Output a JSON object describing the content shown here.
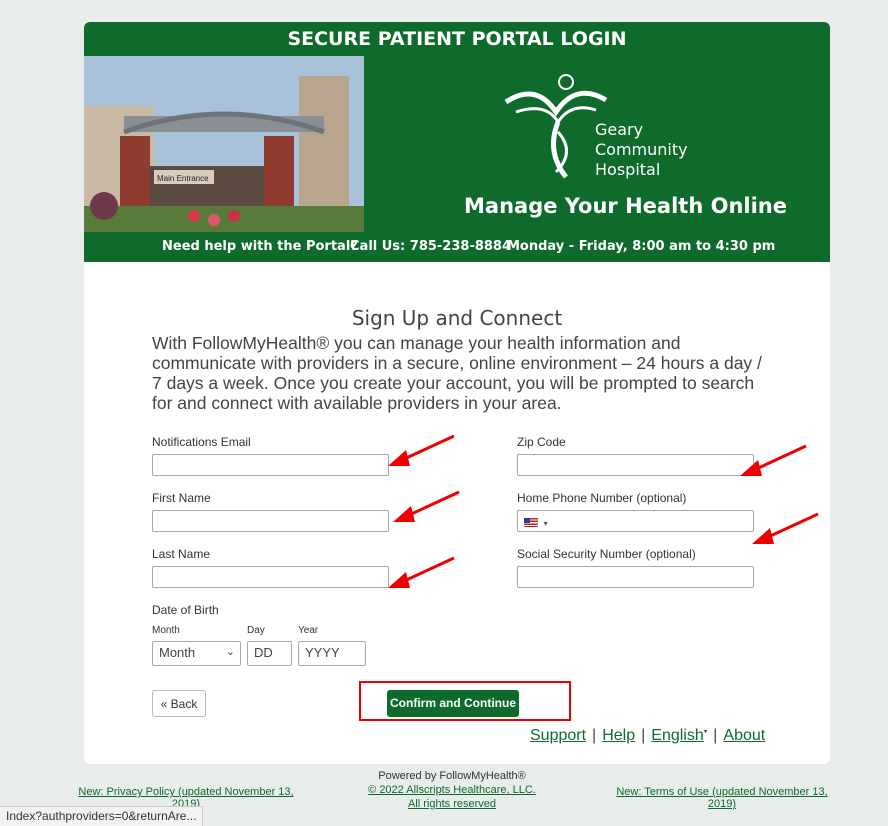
{
  "banner": {
    "title": "SECURE PATIENT PORTAL LOGIN",
    "tagline": "Manage Your Health Online",
    "logo_lines": [
      "Geary",
      "Community",
      "Hospital"
    ],
    "photo_sign": "Main Entrance",
    "help_text": "Need help with the Portal?",
    "phone": "Call Us: 785-238-8884",
    "hours": "Monday - Friday, 8:00 am to 4:30 pm"
  },
  "form": {
    "title": "Sign Up and Connect",
    "intro": "With FollowMyHealth® you can manage your health information and communicate with providers in a secure, online environment – 24 hours a day / 7 days a week. Once you create your account, you will be prompted to search for and connect with available providers in your area.",
    "email_label": "Notifications Email",
    "first_name_label": "First Name",
    "last_name_label": "Last Name",
    "zip_label": "Zip Code",
    "phone_label": "Home Phone Number (optional)",
    "ssn_label": "Social Security Number (optional)",
    "dob_label": "Date of Birth",
    "month_label": "Month",
    "day_label": "Day",
    "year_label": "Year",
    "month_value": "Month",
    "day_placeholder": "DD",
    "year_placeholder": "YYYY",
    "back_label": "« Back",
    "confirm_label": "Confirm and Continue"
  },
  "footer_links": [
    "Support",
    "Help",
    "English",
    "About"
  ],
  "bottom": {
    "privacy": "New: Privacy Policy (updated November 13, 2019)",
    "powered": "Powered by FollowMyHealth®",
    "copyright": "© 2022 Allscripts Healthcare, LLC.",
    "rights": "All rights reserved",
    "terms": "New: Terms of Use (updated November 13, 2019)"
  },
  "status_url": "Index?authproviders=0&returnAre...",
  "colors": {
    "brand_green": "#0e6b2c",
    "annotation_red": "#e00000"
  }
}
